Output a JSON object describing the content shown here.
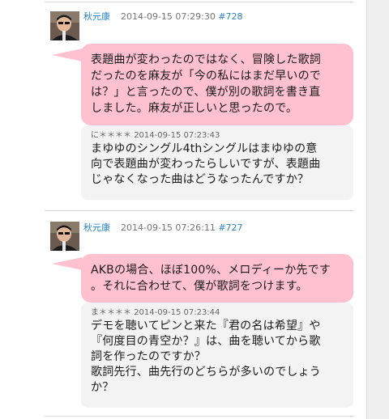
{
  "posts": [
    {
      "author": "秋元康",
      "timestamp": "2014-09-15 07:29:30",
      "post_id": "#728",
      "answer_lines": [
        "表題曲が変わったのではなく、冒険した歌詞",
        "だったのを麻友が「今の私にはまだ早いので",
        "は？」と言ったので、僕が別の歌詞を書き直",
        "しました。麻友が正しいと思ったので。"
      ],
      "question": {
        "asker": "に＊＊＊＊",
        "timestamp": "2014-09-15 07:23:43",
        "lines": [
          "まゆゆのシングル4thシングルはまゆゆの意",
          "向で表題曲が変わったらしいですが、表題曲",
          "じゃなくなった曲はどうなったんですか？"
        ]
      }
    },
    {
      "author": "秋元康",
      "timestamp": "2014-09-15 07:26:11",
      "post_id": "#727",
      "answer_lines": [
        "AKBの場合、ほぼ100%、メロディーか先です",
        "。それに合わせて、僕が歌詞をつけます。"
      ],
      "question": {
        "asker": "ま＊＊＊＊",
        "timestamp": "2014-09-15 07:23:44",
        "lines": [
          "デモを聴いてピンと来た『君の名は希望』や",
          "『何度目の青空か？』は、曲を聴いてから歌",
          "詞を作ったのですか？",
          "歌詞先行、曲先行のどちらが多いのでしょう",
          "か？"
        ]
      }
    }
  ]
}
